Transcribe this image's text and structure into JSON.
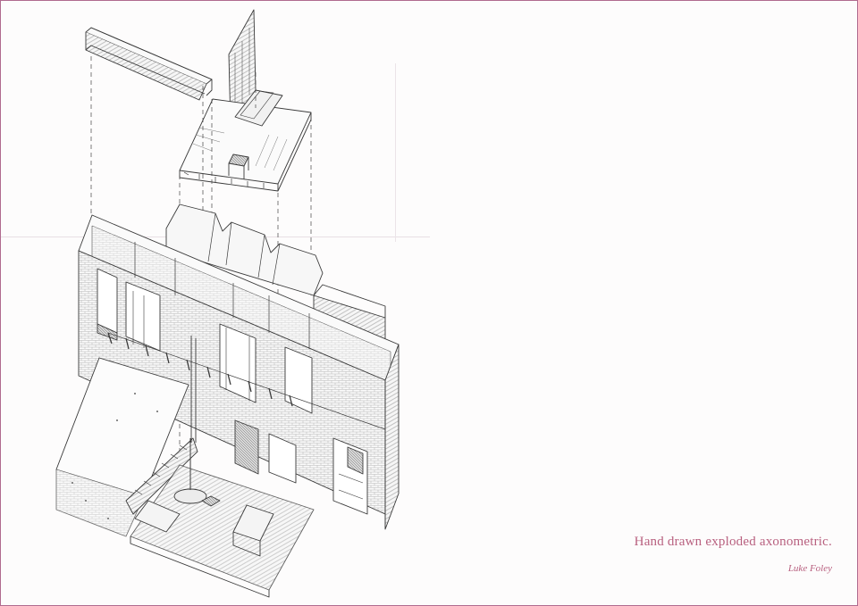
{
  "caption": "Hand drawn exploded axonometric.",
  "author": "Luke Foley",
  "colors": {
    "accent": "#b8607f",
    "border": "#b06b8f",
    "ink": "#3a3a3a"
  }
}
